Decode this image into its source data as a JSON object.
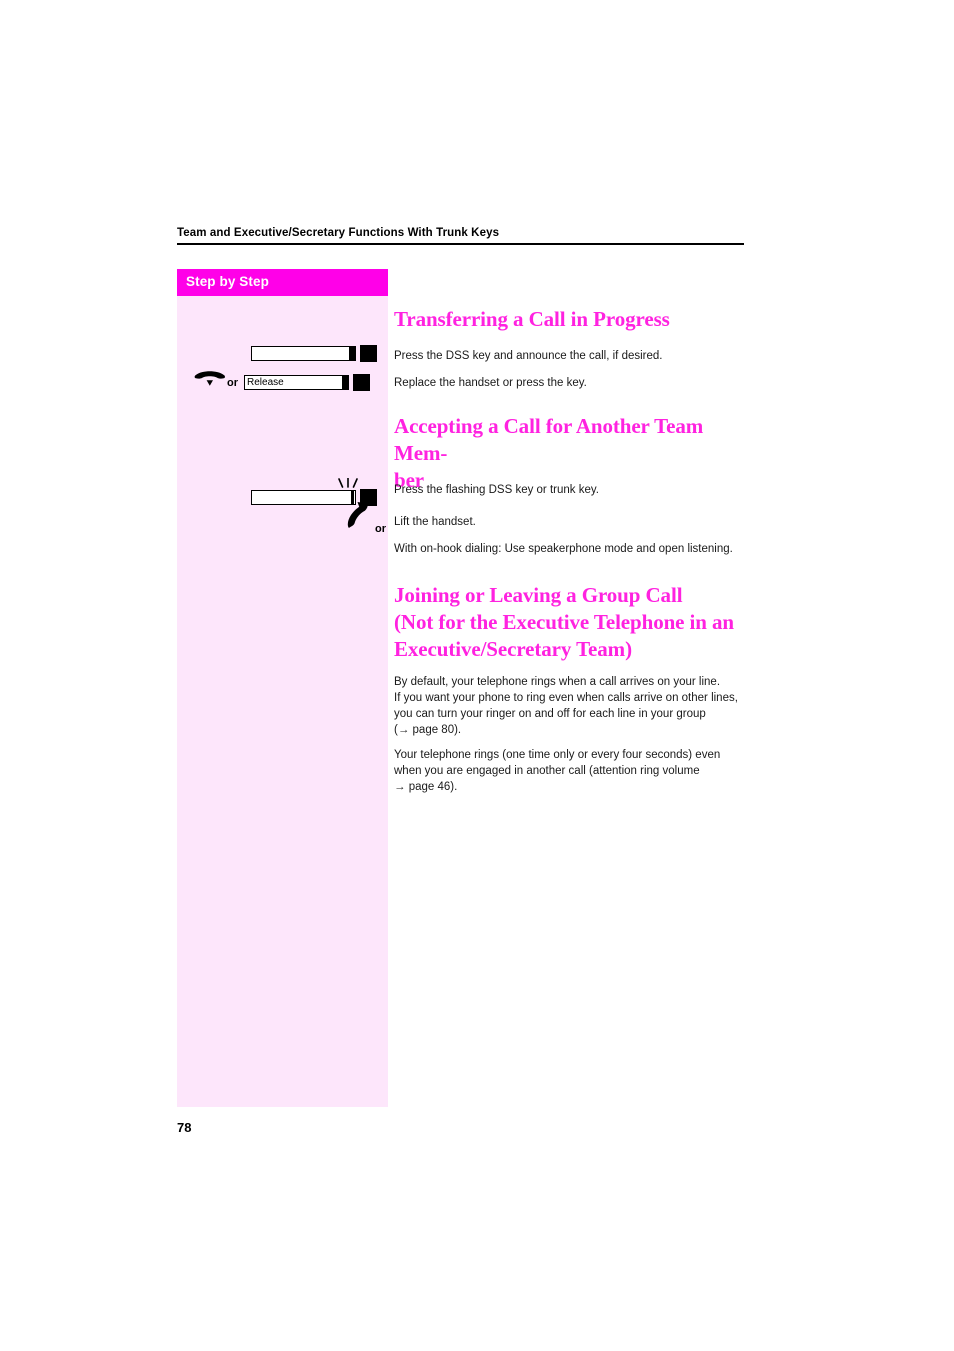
{
  "document": {
    "running_header": "Team and Executive/Secretary Functions With Trunk Keys",
    "folio": "78"
  },
  "sidebar": {
    "header_label": "Step by Step",
    "background_color": "#fde6fb",
    "header_color": "#ff00e8",
    "rows": [
      {
        "id": "transfer-dss-key",
        "key_label": "",
        "or_label": "",
        "icons": [
          "function-key-icon",
          "key-indicator-icon"
        ]
      },
      {
        "id": "release-key",
        "key_label": "Release",
        "or_label": "or",
        "icons": [
          "replace-handset-icon",
          "function-key-icon",
          "key-indicator-icon"
        ]
      },
      {
        "id": "flashing-dss-key",
        "key_label": "",
        "or_label": "",
        "icons": [
          "flashing-function-key-icon",
          "key-indicator-icon"
        ]
      },
      {
        "id": "lift-handset",
        "key_label": "",
        "or_label": "or",
        "icons": [
          "lift-handset-icon"
        ]
      }
    ]
  },
  "content": {
    "sections": [
      {
        "id": "transferring-a-call",
        "heading": "Transferring a Call in Progress",
        "paragraphs": [
          "Press the DSS key and announce the call, if desired.",
          "Replace the handset or press the key."
        ]
      },
      {
        "id": "accepting-a-call",
        "heading": "Accepting a Call for Another Team Mem-\nber",
        "heading_line1": "Accepting a Call for Another Team Mem-",
        "heading_line2": "ber",
        "paragraphs": [
          "Press the flashing DSS key or trunk key.",
          "Lift the handset.",
          "With on-hook dialing: Use speakerphone mode and open listening."
        ]
      },
      {
        "id": "joining-or-leaving-group-call",
        "heading_line1": "Joining or Leaving a Group Call",
        "heading_line2": "(Not for the Executive Telephone in an",
        "heading_line3": "Executive/Secretary Team)",
        "paragraphs": [
          "By default, your telephone rings when a call arrives on your line. If you want your phone to ring even when calls arrive on other lines, you can turn your ringer on and off for each line in your group (→ page 80).",
          "Your telephone rings (one time only or every four seconds) even when you are engaged in another call (attention ring volume → page 46)."
        ],
        "paragraph_lines": {
          "p1": [
            "By default, your telephone rings when a call arrives on your line.",
            "If you want your phone to ring even when calls arrive on other lines,",
            "you can turn your ringer on and off for each line in your group",
            "(→ page 80)."
          ],
          "p2": [
            "Your telephone rings (one time only or every four seconds) even",
            "when you are engaged in another call (attention ring volume",
            "→ page 46)."
          ]
        },
        "page_references": [
          "page 80",
          "page 46"
        ]
      }
    ]
  },
  "colors": {
    "heading_magenta": "#ff22e0",
    "sidebar_header": "#ff00e8",
    "sidebar_body": "#fde6fb",
    "body_text": "#1a1a1a"
  }
}
